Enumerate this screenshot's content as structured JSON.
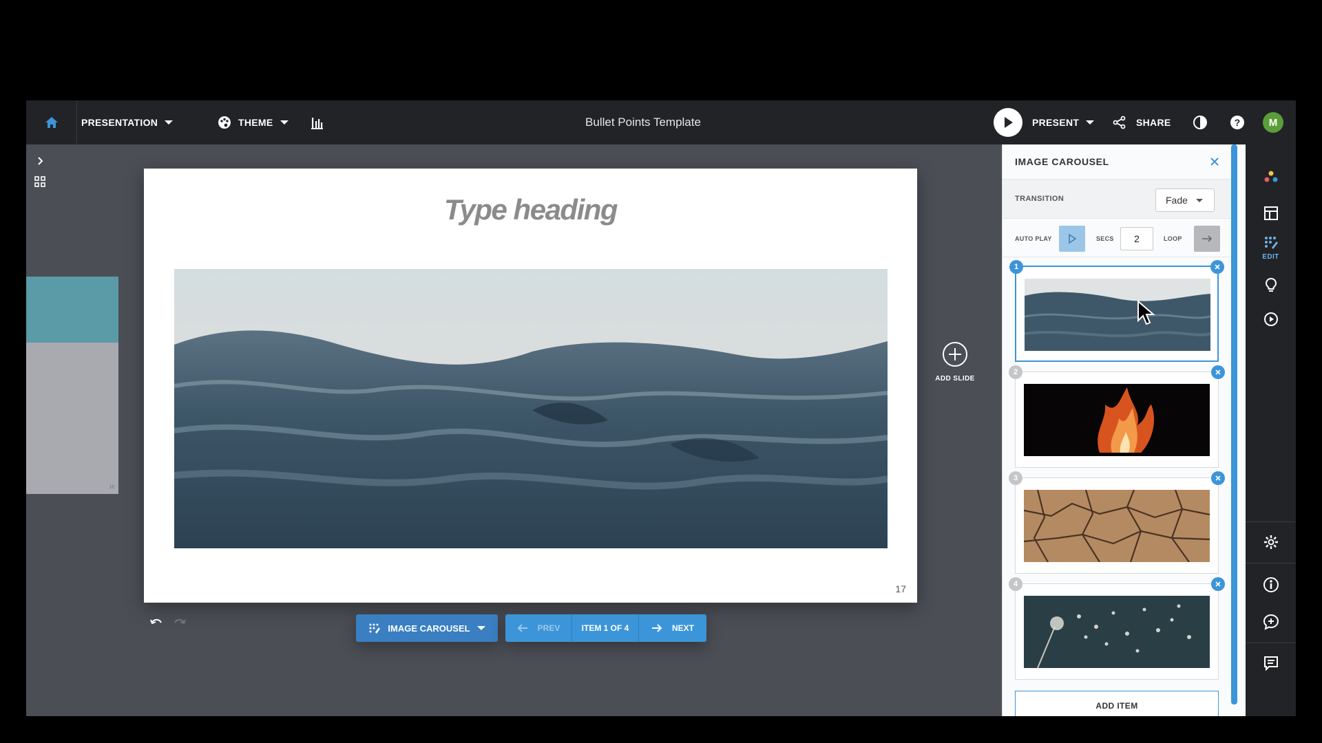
{
  "topbar": {
    "presentation_label": "PRESENTATION",
    "theme_label": "THEME",
    "title": "Bullet Points Template",
    "present_label": "PRESENT",
    "share_label": "SHARE",
    "avatar_initial": "M"
  },
  "slide": {
    "heading": "Type heading",
    "number": "17"
  },
  "add_slide": {
    "label": "ADD SLIDE"
  },
  "bottom_toolbar": {
    "carousel_label": "IMAGE CAROUSEL",
    "prev_label": "PREV",
    "item_label": "ITEM 1 OF 4",
    "next_label": "NEXT"
  },
  "panel": {
    "title": "IMAGE CAROUSEL",
    "transition_label": "TRANSITION",
    "transition_value": "Fade",
    "autoplay_label": "AUTO PLAY",
    "secs_label": "SECS",
    "secs_value": "2",
    "loop_label": "LOOP",
    "items": [
      {
        "number": "1",
        "image": "ocean-waves",
        "selected": true
      },
      {
        "number": "2",
        "image": "fire-flames",
        "selected": false
      },
      {
        "number": "3",
        "image": "cracked-earth",
        "selected": false
      },
      {
        "number": "4",
        "image": "dandelion-seeds",
        "selected": false
      }
    ],
    "add_item_label": "ADD ITEM"
  },
  "rail": {
    "edit_label": "EDIT"
  },
  "colors": {
    "accent": "#3c95d8",
    "topbar": "#222326",
    "workspace": "#4b4e55",
    "avatar": "#5a9e3a"
  }
}
